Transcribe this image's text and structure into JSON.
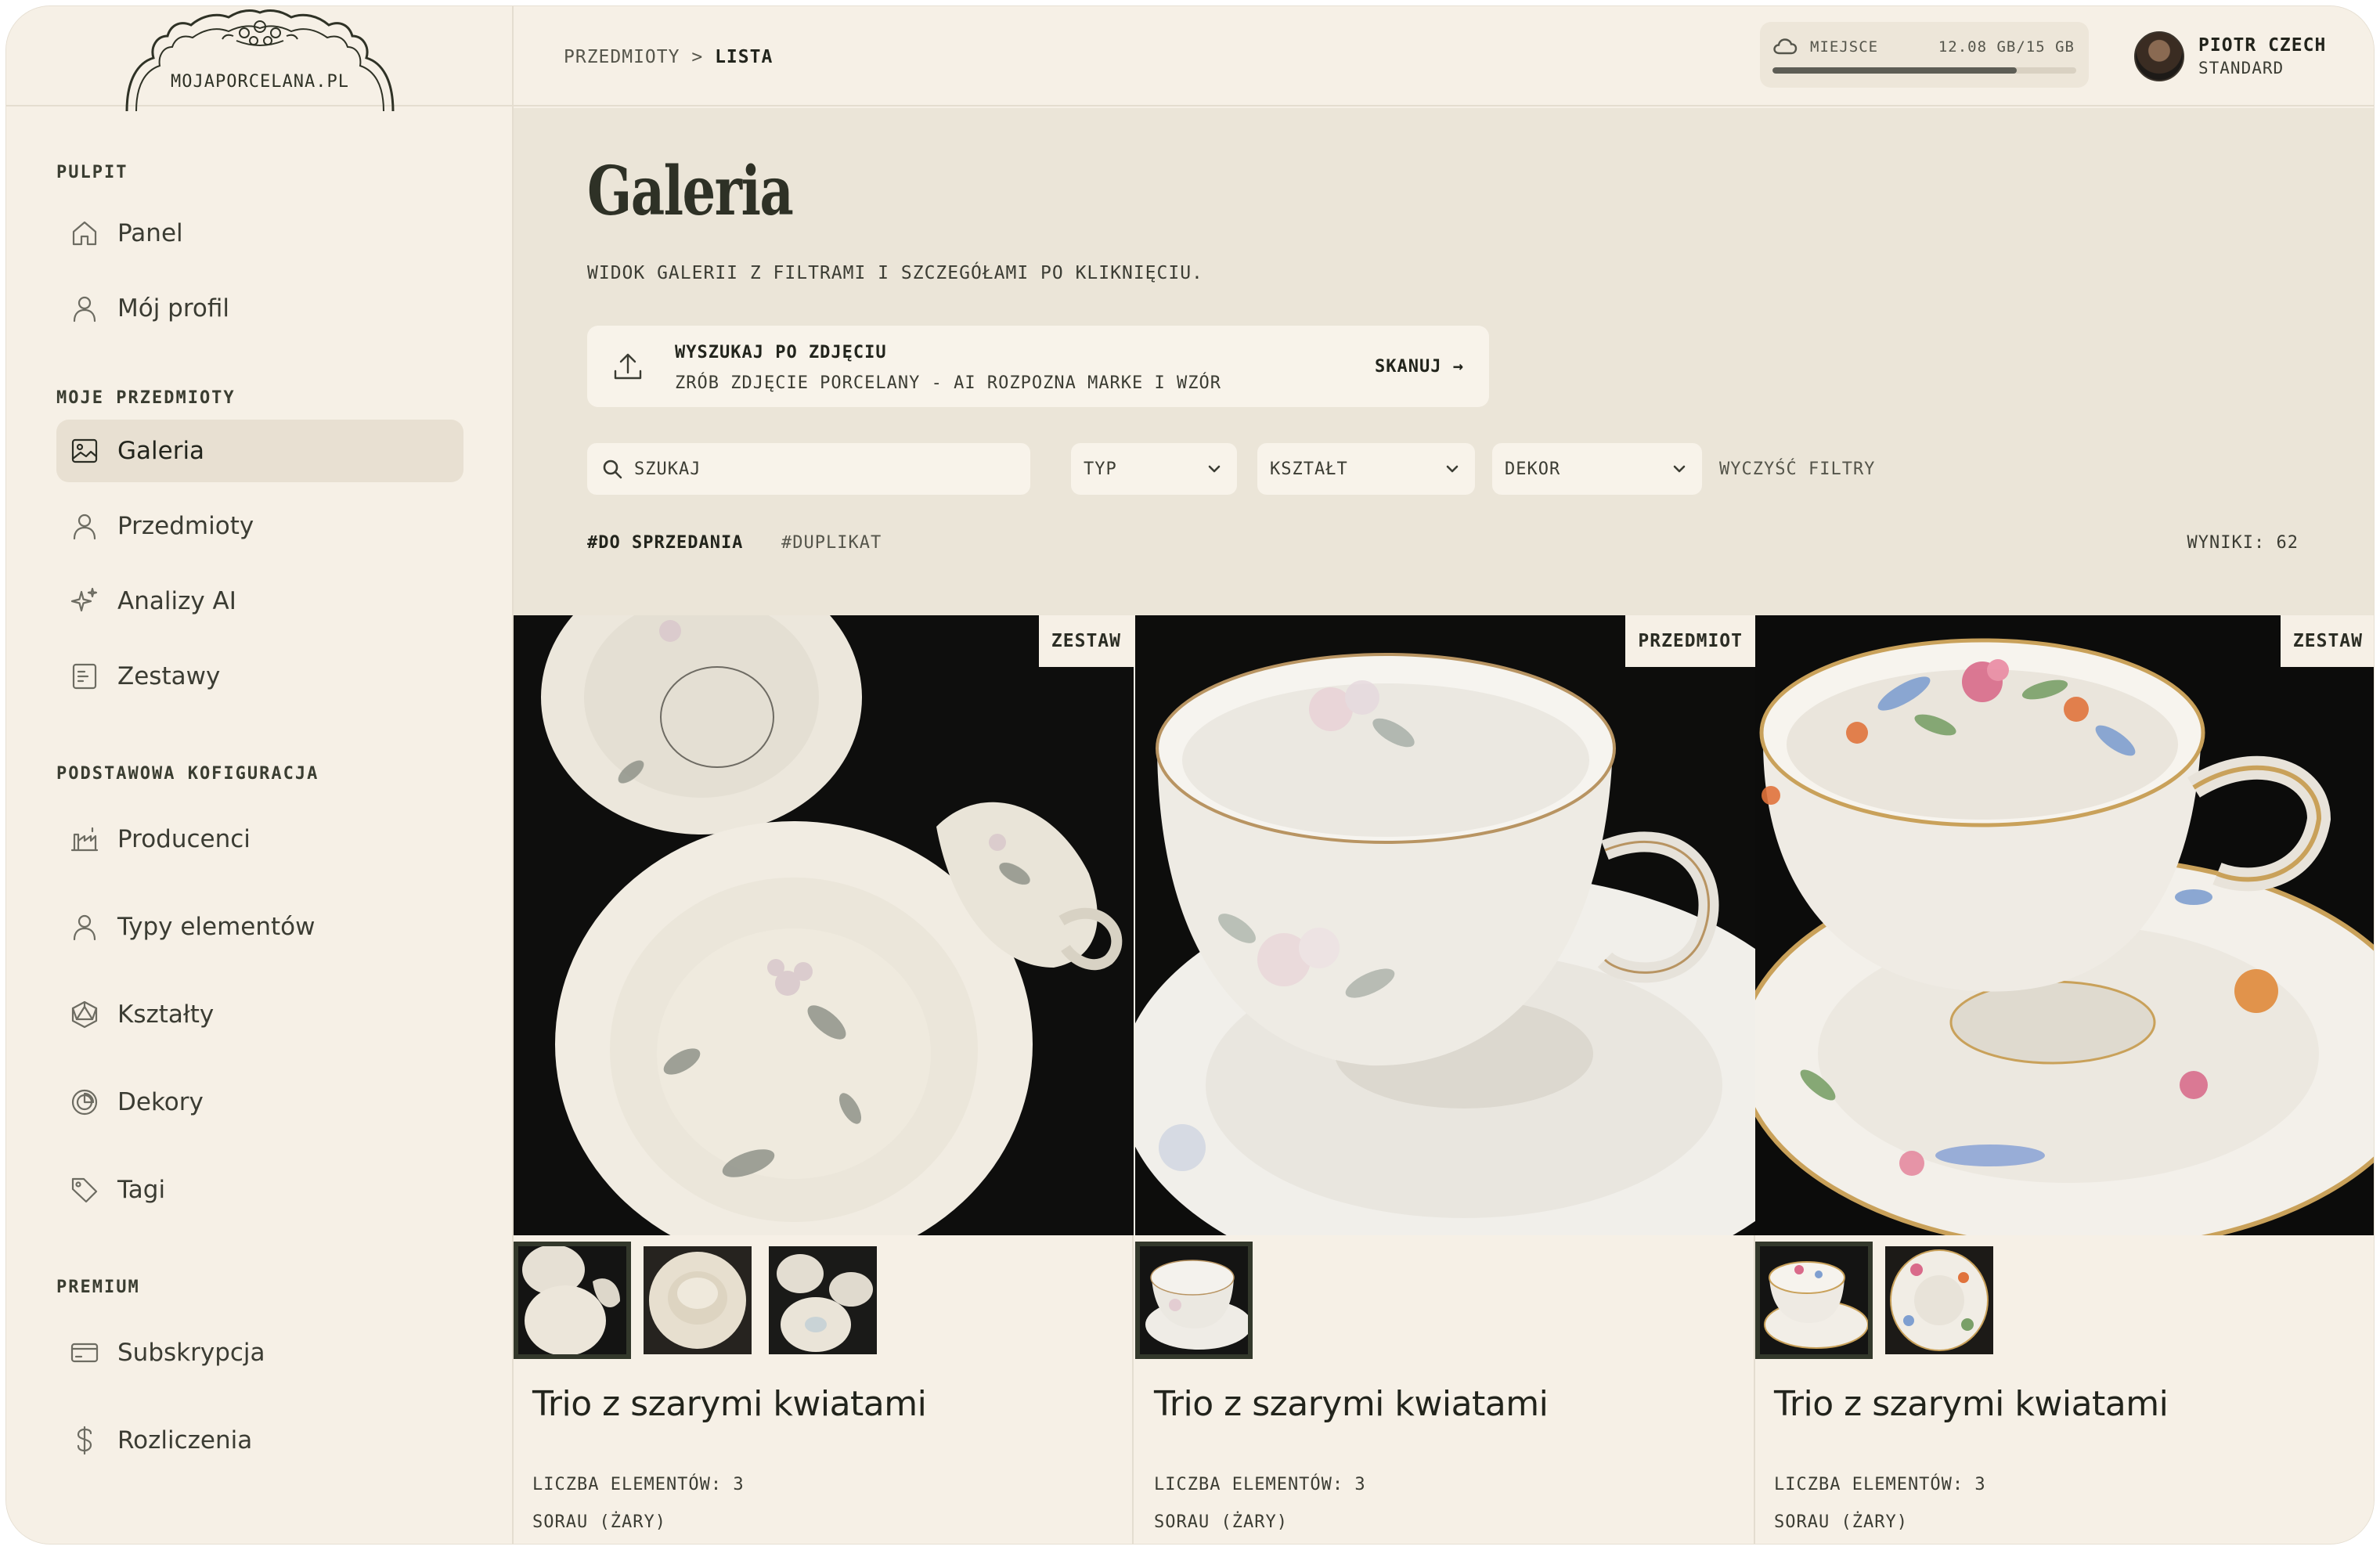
{
  "brand": {
    "name": "MOJAPORCELANA.PL"
  },
  "sidebar": {
    "sections": [
      {
        "label": "PULPIT"
      },
      {
        "label": "MOJE PRZEDMIOTY"
      },
      {
        "label": "PODSTAWOWA KOFIGURACJA"
      },
      {
        "label": "PREMIUM"
      }
    ],
    "items": [
      {
        "label": "Panel",
        "icon": "home-icon"
      },
      {
        "label": "Mój profil",
        "icon": "user-icon"
      },
      {
        "label": "Galeria",
        "icon": "image-icon",
        "active": true
      },
      {
        "label": "Przedmioty",
        "icon": "user-icon"
      },
      {
        "label": "Analizy AI",
        "icon": "sparkles-icon"
      },
      {
        "label": "Zestawy",
        "icon": "document-icon"
      },
      {
        "label": "Producenci",
        "icon": "factory-icon"
      },
      {
        "label": "Typy elementów",
        "icon": "user-icon"
      },
      {
        "label": "Kształty",
        "icon": "polygon-icon"
      },
      {
        "label": "Dekory",
        "icon": "pie-icon"
      },
      {
        "label": "Tagi",
        "icon": "tag-icon"
      },
      {
        "label": "Subskrypcja",
        "icon": "card-icon"
      },
      {
        "label": "Rozliczenia",
        "icon": "dollar-icon"
      }
    ]
  },
  "topbar": {
    "breadcrumb": {
      "parent": "PRZEDMIOTY",
      "separator": ">",
      "current": "LISTA"
    },
    "storage": {
      "label": "MIEJSCE",
      "value": "12.08 GB/15 GB",
      "fraction": 0.805
    },
    "user": {
      "name": "PIOTR CZECH",
      "plan": "STANDARD"
    }
  },
  "main": {
    "title": "Galeria",
    "subtitle": "WIDOK GALERII Z FILTRAMI I SZCZEGÓŁAMI PO KLIKNIĘCIU.",
    "scan": {
      "title": "WYSZUKAJ PO ZDJĘCIU",
      "description": "ZRÓB ZDJĘCIE PORCELANY - AI ROZPOZNA MARKE I WZÓR",
      "button": "SKANUJ →"
    },
    "filters": {
      "search_placeholder": "SZUKAJ",
      "type": "TYP",
      "shape": "KSZTAŁT",
      "decor": "DEKOR",
      "clear": "WYCZYŚĆ FILTRY"
    },
    "tags": [
      "#DO SPRZEDANIA",
      "#DUPLIKAT"
    ],
    "results": "WYNIKI: 62"
  },
  "cards": [
    {
      "badge": "ZESTAW",
      "title": "Trio z szarymi kwiatami",
      "count": "LICZBA ELEMENTÓW: 3",
      "maker": "SORAU (ŻARY)",
      "thumbs": 3
    },
    {
      "badge": "PRZEDMIOT",
      "title": "Trio z szarymi kwiatami",
      "count": "LICZBA ELEMENTÓW: 3",
      "maker": "SORAU (ŻARY)",
      "thumbs": 1
    },
    {
      "badge": "ZESTAW",
      "title": "Trio z szarymi kwiatami",
      "count": "LICZBA ELEMENTÓW: 3",
      "maker": "SORAU (ŻARY)",
      "thumbs": 2
    }
  ],
  "colors": {
    "background": "#f6f0e6",
    "header_bg": "#ebe5d8",
    "active_item": "#e8e0d2",
    "text": "#22241c"
  }
}
